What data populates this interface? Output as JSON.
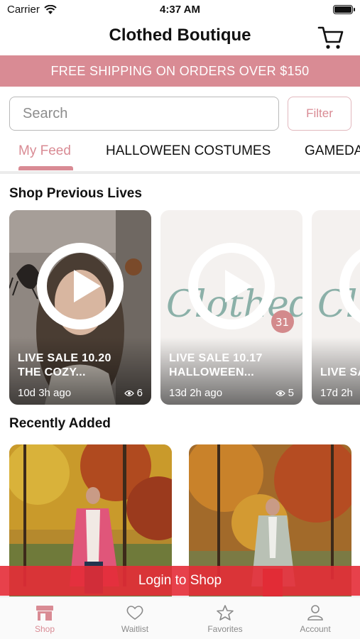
{
  "status_bar": {
    "carrier": "Carrier",
    "time": "4:37 AM"
  },
  "header": {
    "title": "Clothed Boutique"
  },
  "banner": {
    "text": "FREE SHIPPING ON ORDERS OVER $150"
  },
  "search": {
    "placeholder": "Search",
    "filter_label": "Filter"
  },
  "tabs": [
    {
      "label": "My Feed",
      "active": true
    },
    {
      "label": "HALLOWEEN COSTUMES",
      "active": false
    },
    {
      "label": "GAMEDA",
      "active": false
    }
  ],
  "previous_lives": {
    "title": "Shop Previous Lives",
    "items": [
      {
        "title_line1": "LIVE SALE 10.20",
        "title_line2": "THE COZY...",
        "ago": "10d 3h ago",
        "views": "6"
      },
      {
        "title_line1": "LIVE SALE 10.17",
        "title_line2": "HALLOWEEN...",
        "ago": "13d 2h ago",
        "views": "5",
        "logo_text": "Clothed",
        "logo_badge": "31"
      },
      {
        "title_line1": "LIVE SALE",
        "title_line2": "",
        "ago": "17d 2h",
        "views": "",
        "logo_text": "Cl"
      }
    ]
  },
  "recently_added": {
    "title": "Recently Added"
  },
  "login_bar": {
    "label": "Login to Shop"
  },
  "tab_bar": [
    {
      "label": "Shop",
      "icon": "store-icon",
      "active": true
    },
    {
      "label": "Waitlist",
      "icon": "heart-icon",
      "active": false
    },
    {
      "label": "Favorites",
      "icon": "star-icon",
      "active": false
    },
    {
      "label": "Account",
      "icon": "person-icon",
      "active": false
    }
  ],
  "colors": {
    "accent": "#d98b94",
    "banner": "#d98b94",
    "login": "#e42c37"
  }
}
